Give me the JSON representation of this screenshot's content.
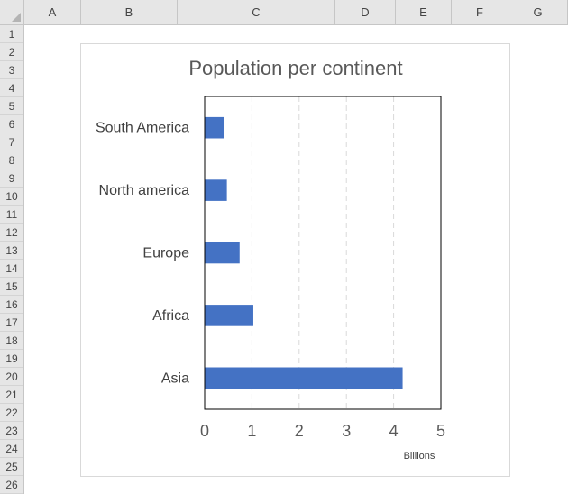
{
  "spreadsheet": {
    "columns": [
      "A",
      "B",
      "C",
      "D",
      "E",
      "F",
      "G"
    ],
    "rows": [
      "1",
      "2",
      "3",
      "4",
      "5",
      "6",
      "7",
      "8",
      "9",
      "10",
      "11",
      "12",
      "13",
      "14",
      "15",
      "16",
      "17",
      "18",
      "19",
      "20",
      "21",
      "22",
      "23",
      "24",
      "25",
      "26"
    ]
  },
  "chart_data": {
    "type": "bar",
    "orientation": "horizontal",
    "title": "Population per continent",
    "categories": [
      "South America",
      "North america",
      "Europe",
      "Africa",
      "Asia"
    ],
    "values": [
      0.42,
      0.47,
      0.74,
      1.03,
      4.19
    ],
    "xlim": [
      0,
      5
    ],
    "xticks": [
      "0",
      "1",
      "2",
      "3",
      "4",
      "5"
    ],
    "display_units": "Billions",
    "grid": "vertical-dashed",
    "legend": "none",
    "bar_color": "#4472c4"
  }
}
